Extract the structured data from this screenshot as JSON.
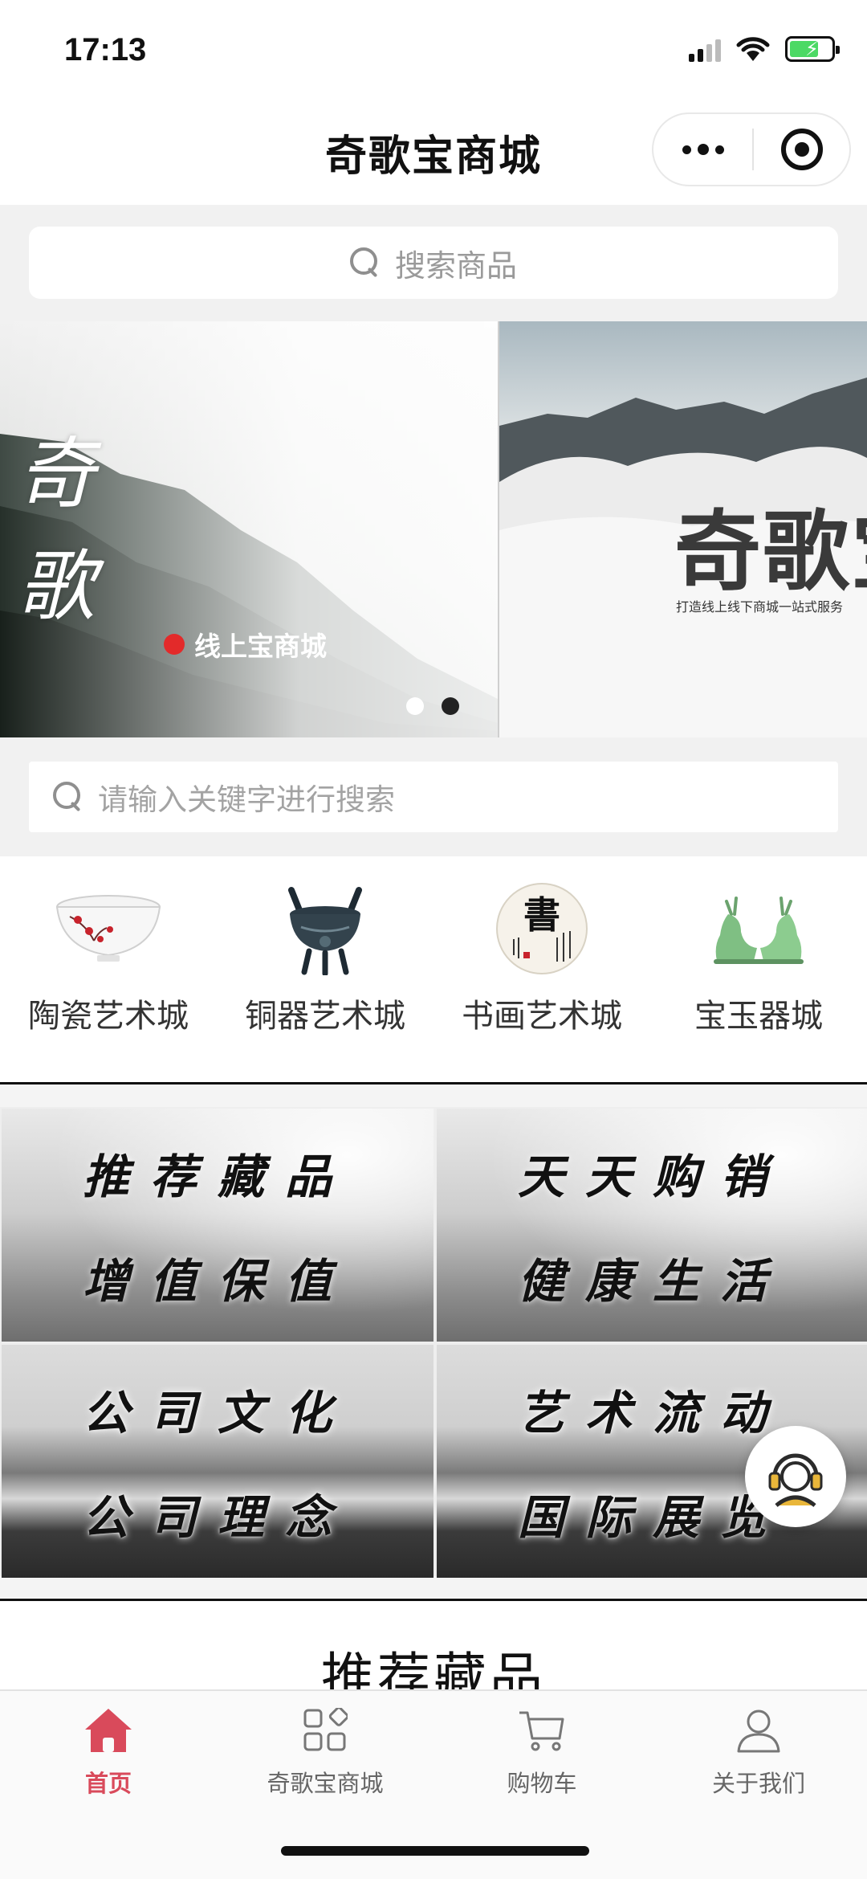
{
  "status_bar": {
    "time": "17:13"
  },
  "title_bar": {
    "title": "奇歌宝商城"
  },
  "search_top": {
    "placeholder": "搜索商品"
  },
  "banner": {
    "slides": [
      {
        "title_vertical": "奇歌",
        "tag": "线上宝商城"
      },
      {
        "title": "奇歌宝",
        "subtitle": "打造线上线下商城一站式服务"
      }
    ],
    "active_index": 0
  },
  "search_keyword": {
    "placeholder": "请输入关键字进行搜索"
  },
  "categories": [
    {
      "label": "陶瓷艺术城",
      "icon": "porcelain-bowl-icon"
    },
    {
      "label": "铜器艺术城",
      "icon": "bronze-censer-icon"
    },
    {
      "label": "书画艺术城",
      "icon": "calligraphy-icon"
    },
    {
      "label": "宝玉器城",
      "icon": "jade-deer-icon"
    }
  ],
  "feature_tiles": [
    {
      "line1": "推荐藏品",
      "line2": "增值保值"
    },
    {
      "line1": "天天购销",
      "line2": "健康生活"
    },
    {
      "line1": "公司文化",
      "line2": "公司理念"
    },
    {
      "line1": "艺术流动",
      "line2": "国际展览"
    }
  ],
  "section": {
    "title": "推荐藏品"
  },
  "tab_bar": {
    "items": [
      {
        "label": "首页",
        "icon": "home-icon",
        "active": true
      },
      {
        "label": "奇歌宝商城",
        "icon": "grid-icon",
        "active": false
      },
      {
        "label": "购物车",
        "icon": "cart-icon",
        "active": false
      },
      {
        "label": "关于我们",
        "icon": "user-icon",
        "active": false
      }
    ]
  },
  "colors": {
    "accent": "#d94a5b",
    "banner_dot": "#e32a2a",
    "battery": "#4cd964"
  }
}
